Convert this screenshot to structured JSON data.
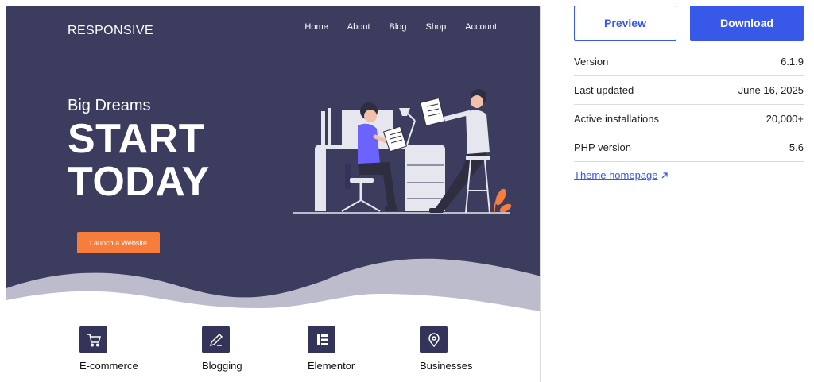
{
  "preview": {
    "brand": "RESPONSIVE",
    "nav": [
      "Home",
      "About",
      "Blog",
      "Shop",
      "Account"
    ],
    "hero_subtitle": "Big Dreams",
    "hero_title_line1": "START",
    "hero_title_line2": "TODAY",
    "cta_label": "Launch a Website",
    "features": [
      {
        "label": "E-commerce",
        "icon": "cart-icon"
      },
      {
        "label": "Blogging",
        "icon": "pencil-icon"
      },
      {
        "label": "Elementor",
        "icon": "elementor-icon"
      },
      {
        "label": "Businesses",
        "icon": "location-pin-icon"
      }
    ],
    "colors": {
      "hero_bg": "#3c3c5f",
      "cta": "#f77d3d",
      "wave": "#bcbccd",
      "icon_bg": "#34345a"
    }
  },
  "actions": {
    "preview_label": "Preview",
    "download_label": "Download",
    "accent": "#3858e9"
  },
  "meta": {
    "rows": [
      {
        "label": "Version",
        "value": "6.1.9"
      },
      {
        "label": "Last updated",
        "value": "June 16, 2025"
      },
      {
        "label": "Active installations",
        "value": "20,000+"
      },
      {
        "label": "PHP version",
        "value": "5.6"
      }
    ],
    "homepage_link": "Theme homepage",
    "homepage_icon": "external-arrow-icon"
  }
}
